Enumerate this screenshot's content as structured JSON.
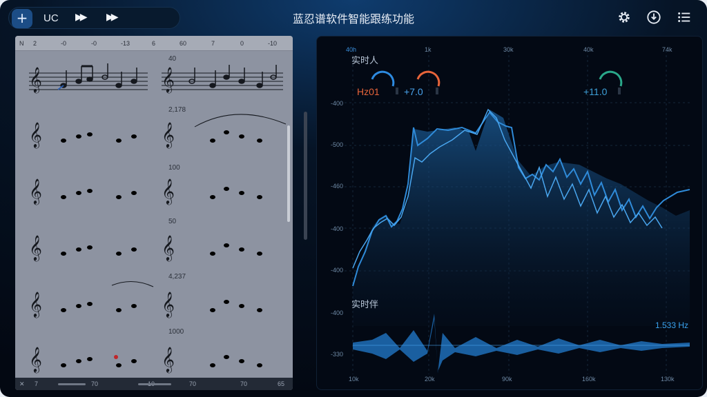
{
  "app": {
    "title": "蓝忍谱软件智能跟练功能",
    "accent": "#1c4d86"
  },
  "toolbar": {
    "add_icon": "plus-icon",
    "add_label": "+",
    "uc_label": "UC",
    "forward1_label": "▶▶",
    "forward2_label": "▶▶",
    "settings_icon": "gear-icon",
    "info_icon": "download-circle-icon",
    "menu_icon": "list-menu-icon"
  },
  "score": {
    "top_ruler": [
      "N",
      "2",
      "-0",
      "-0",
      "-13",
      "6",
      "60",
      "7",
      "0",
      "-10"
    ],
    "bottom_ruler": [
      "✕",
      "7",
      "70",
      "10",
      "70",
      "70",
      "65"
    ],
    "measure_labels": [
      "40",
      "2,178",
      "100",
      "50",
      "4,237",
      "1000"
    ],
    "clef": "𝄞",
    "key": "♯"
  },
  "spectrum": {
    "title_top": "实时人",
    "title_bottom": "实时伴",
    "freq_labels_top": [
      "40h",
      "1k",
      "30k",
      "40k",
      "74k"
    ],
    "freq_labels_bottom": [
      "10k",
      "20k",
      "90k",
      "160k",
      "130k"
    ],
    "db_labels": [
      "-400",
      "-500",
      "-460",
      "-400",
      "-400",
      "-400",
      "-330"
    ],
    "knobs": [
      {
        "label": "Hz01",
        "color": "#e7643a",
        "arc": "#2d8ae0"
      },
      {
        "label": "+7.0",
        "color": "#49a3ec",
        "arc": "#e7643a"
      },
      {
        "label": "+11.0",
        "color": "#3ea0d8",
        "arc": "#2aa88a"
      }
    ],
    "waveform_value": "1.533 Hz",
    "line_color": "#2f8bd9"
  }
}
